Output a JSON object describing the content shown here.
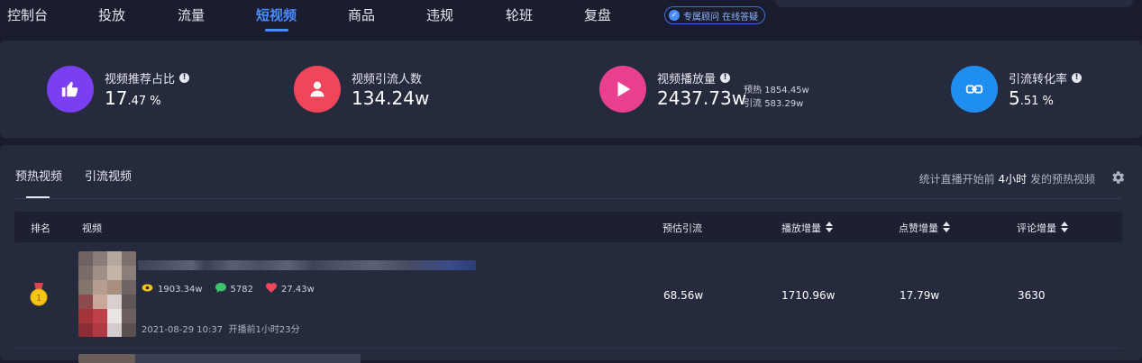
{
  "nav": {
    "items": [
      {
        "label": "控制台"
      },
      {
        "label": "投放"
      },
      {
        "label": "流量"
      },
      {
        "label": "短视频"
      },
      {
        "label": "商品"
      },
      {
        "label": "违规"
      },
      {
        "label": "轮班"
      },
      {
        "label": "复盘"
      }
    ],
    "active_index": 3,
    "consult_label": "专属顾问 在线答疑"
  },
  "stats": [
    {
      "label": "视频推荐占比",
      "value_main": "17",
      "value_small": ".47 %",
      "icon": "thumbs-up-icon",
      "color": "#7b3ff2"
    },
    {
      "label": "视频引流人数",
      "value_main": "134.24w",
      "value_small": "",
      "icon": "user-icon",
      "color": "#f0455a"
    },
    {
      "label": "视频播放量",
      "value_main": "2437.73w",
      "value_small": "",
      "icon": "play-icon",
      "color": "#e83f8e",
      "sub": [
        {
          "label": "预热",
          "value": "1854.45w"
        },
        {
          "label": "引流",
          "value": "583.29w"
        }
      ]
    },
    {
      "label": "引流转化率",
      "value_main": "5",
      "value_small": ".51 %",
      "icon": "conversion-icon",
      "color": "#1f8ef1"
    }
  ],
  "tabs": [
    {
      "label": "预热视频"
    },
    {
      "label": "引流视频"
    }
  ],
  "hint": {
    "prefix": "统计直播开始前",
    "hours": "4小时",
    "suffix": "发的预热视频"
  },
  "table": {
    "headers": {
      "rank": "排名",
      "video": "视频",
      "est_traffic": "预估引流",
      "play_inc": "播放增量",
      "like_inc": "点赞增量",
      "comment_inc": "评论增量"
    },
    "rows": [
      {
        "rank": "1",
        "plays": "1903.34w",
        "comments": "5782",
        "likes": "27.43w",
        "time": "2021-08-29 10:37",
        "time_note": "开播前1小时23分",
        "est_traffic": "68.56w",
        "play_inc": "1710.96w",
        "like_inc": "17.79w",
        "comment_inc": "3630"
      }
    ]
  },
  "colors": {
    "accent": "#4a8cff",
    "background": "#1a1d2e",
    "panel": "#262a3d",
    "medal": "#f5c518"
  }
}
